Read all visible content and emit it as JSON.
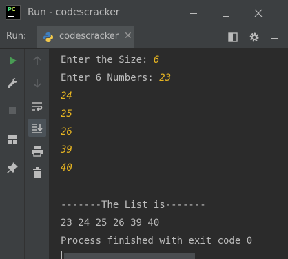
{
  "window": {
    "title": "Run - codescracker"
  },
  "run_panel": {
    "label": "Run:",
    "tab_label": "codescracker"
  },
  "console": {
    "size_prompt": "Enter the Size: ",
    "size_input": "6",
    "numbers_prompt": "Enter 6 Numbers: ",
    "inputs": [
      "23",
      "24",
      "25",
      "26",
      "39",
      "40"
    ],
    "list_header": "-------The List is-------",
    "list_output": "23 24 25 26 39 40",
    "exit_message": "Process finished with exit code 0"
  },
  "colors": {
    "background": "#2b2b2b",
    "panel": "#3c3f41",
    "text": "#bbbbbb",
    "user_input": "#e6b422",
    "run_green": "#499c54"
  },
  "icons": {
    "titlebar": [
      "pycharm-logo-icon",
      "minimize-icon",
      "maximize-icon",
      "close-icon"
    ],
    "tabbar": [
      "python-file-icon",
      "layout-icon",
      "gear-icon",
      "minimize-panel-icon"
    ],
    "left_toolbar": [
      "rerun-icon",
      "wrench-icon",
      "stop-icon",
      "layout-icon",
      "pin-icon"
    ],
    "second_toolbar": [
      "up-arrow-icon",
      "down-arrow-icon",
      "soft-wrap-icon",
      "scroll-to-end-icon",
      "print-icon",
      "trash-icon"
    ]
  }
}
